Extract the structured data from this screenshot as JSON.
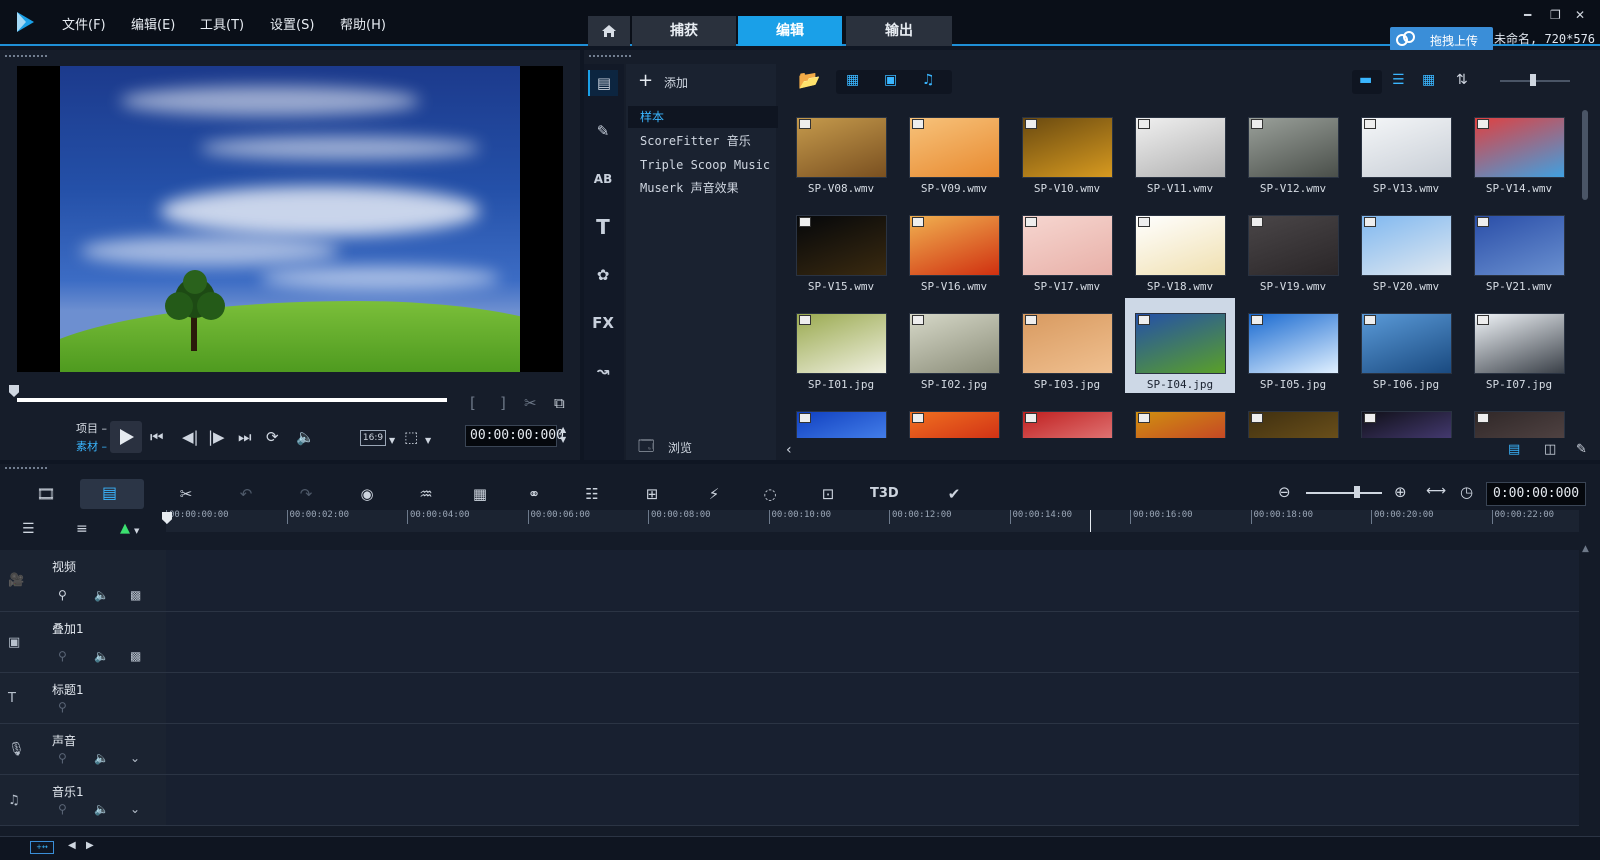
{
  "app": {
    "menu": [
      "文件(F)",
      "编辑(E)",
      "工具(T)",
      "设置(S)",
      "帮助(H)"
    ],
    "tabs": [
      "捕获",
      "编辑",
      "输出"
    ],
    "active_tab": "编辑",
    "cloud_button": "拖拽上传",
    "project_info": "未命名, 720*576",
    "accent": "#1aa0e8"
  },
  "preview": {
    "mode_project": "项目",
    "mode_clip": "素材",
    "aspect": "16:9",
    "timecode": "00:00:00:000"
  },
  "library": {
    "add_label": "添加",
    "browse_label": "浏览",
    "folders": [
      "样本",
      "ScoreFitter 音乐",
      "Triple Scoop Music",
      "Muserk 声音效果"
    ],
    "selected_folder": "样本",
    "side_icons": [
      "media-icon",
      "instant-project-icon",
      "transition-icon",
      "title-icon",
      "graphic-icon",
      "filter-icon",
      "path-icon"
    ],
    "fx_label": "FX",
    "items": [
      {
        "label": "SP-V08.wmv",
        "type": "video",
        "colors": [
          "#c59a4c",
          "#7a5020"
        ]
      },
      {
        "label": "SP-V09.wmv",
        "type": "video",
        "colors": [
          "#f7c27a",
          "#e88a30"
        ]
      },
      {
        "label": "SP-V10.wmv",
        "type": "video",
        "colors": [
          "#6a4a10",
          "#d79a20"
        ]
      },
      {
        "label": "SP-V11.wmv",
        "type": "video",
        "colors": [
          "#f0f0f0",
          "#b0b0b0"
        ]
      },
      {
        "label": "SP-V12.wmv",
        "type": "video",
        "colors": [
          "#9aa09a",
          "#4a4f4a"
        ]
      },
      {
        "label": "SP-V13.wmv",
        "type": "video",
        "colors": [
          "#f4f6f8",
          "#c8ced6"
        ]
      },
      {
        "label": "SP-V14.wmv",
        "type": "video",
        "colors": [
          "#e04040",
          "#40a0e0"
        ]
      },
      {
        "label": "SP-V15.wmv",
        "type": "video",
        "colors": [
          "#05070a",
          "#3a2a10"
        ]
      },
      {
        "label": "SP-V16.wmv",
        "type": "video",
        "colors": [
          "#f0b050",
          "#d03010"
        ]
      },
      {
        "label": "SP-V17.wmv",
        "type": "video",
        "colors": [
          "#f6d6d0",
          "#e8b0a8"
        ]
      },
      {
        "label": "SP-V18.wmv",
        "type": "video",
        "colors": [
          "#ffffff",
          "#f0e0b0"
        ]
      },
      {
        "label": "SP-V19.wmv",
        "type": "video",
        "colors": [
          "#4a4648",
          "#2a2628"
        ]
      },
      {
        "label": "SP-V20.wmv",
        "type": "video",
        "colors": [
          "#80b8f0",
          "#e0e8f0"
        ]
      },
      {
        "label": "SP-V21.wmv",
        "type": "video",
        "colors": [
          "#2a4ea8",
          "#6a90d0"
        ]
      },
      {
        "label": "SP-I01.jpg",
        "type": "image",
        "colors": [
          "#9aaa50",
          "#f0f0e0"
        ]
      },
      {
        "label": "SP-I02.jpg",
        "type": "image",
        "colors": [
          "#d6d8c8",
          "#8a8c78"
        ]
      },
      {
        "label": "SP-I03.jpg",
        "type": "image",
        "colors": [
          "#d89a60",
          "#f0c090"
        ]
      },
      {
        "label": "SP-I04.jpg",
        "type": "image",
        "colors": [
          "#2450a8",
          "#5aa028"
        ]
      },
      {
        "label": "SP-I05.jpg",
        "type": "image",
        "colors": [
          "#1a6ad0",
          "#e0f0ff"
        ]
      },
      {
        "label": "SP-I06.jpg",
        "type": "image",
        "colors": [
          "#5a9ad8",
          "#1a4a80"
        ]
      },
      {
        "label": "SP-I07.jpg",
        "type": "image",
        "colors": [
          "#f0f4f8",
          "#3a4048"
        ]
      },
      {
        "label": "",
        "type": "image",
        "colors": [
          "#1040c0",
          "#60a0ff"
        ]
      },
      {
        "label": "",
        "type": "image",
        "colors": [
          "#f07020",
          "#c01010"
        ]
      },
      {
        "label": "",
        "type": "image",
        "colors": [
          "#c02020",
          "#f0a0a0"
        ]
      },
      {
        "label": "",
        "type": "image",
        "colors": [
          "#d09010",
          "#c02030"
        ]
      },
      {
        "label": "",
        "type": "image",
        "colors": [
          "#403010",
          "#806020"
        ]
      },
      {
        "label": "",
        "type": "image",
        "colors": [
          "#101018",
          "#6050a0"
        ]
      },
      {
        "label": "",
        "type": "image",
        "colors": [
          "#302828",
          "#605050"
        ]
      }
    ],
    "selected_item": "SP-I04.jpg"
  },
  "timeline": {
    "timecode": "0:00:00:000",
    "ruler": [
      "00:00:00:00",
      "00:00:02:00",
      "00:00:04:00",
      "00:00:06:00",
      "00:00:08:00",
      "00:00:10:00",
      "00:00:12:00",
      "00:00:14:00",
      "00:00:16:00",
      "00:00:18:00",
      "00:00:20:00",
      "00:00:22:00"
    ],
    "tracks": [
      {
        "name": "视频",
        "icon": "video-track-icon"
      },
      {
        "name": "叠加1",
        "icon": "overlay-track-icon"
      },
      {
        "name": "标题1",
        "icon": "title-track-icon"
      },
      {
        "name": "声音",
        "icon": "voice-track-icon"
      },
      {
        "name": "音乐1",
        "icon": "music-track-icon"
      }
    ],
    "tools_3d_label": "T3D"
  }
}
